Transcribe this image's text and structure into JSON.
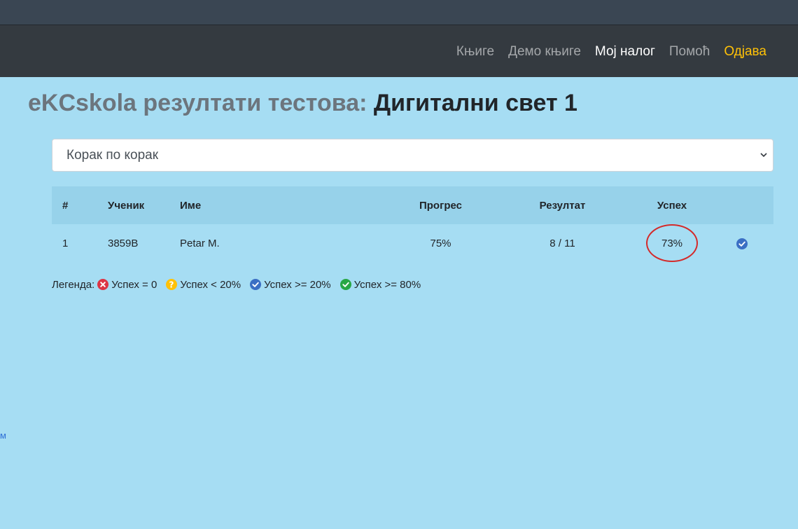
{
  "nav": {
    "items": [
      {
        "label": "Књиге"
      },
      {
        "label": "Демо књиге"
      },
      {
        "label": "Мој налог"
      },
      {
        "label": "Помоћ"
      },
      {
        "label": "Одјава"
      }
    ],
    "active_item": "Мој налог"
  },
  "page": {
    "title_prefix": "eKCskola резултати тестова:",
    "title_book": "Дигитални свет 1"
  },
  "lesson_select": {
    "selected": "Корак по корак"
  },
  "table": {
    "headers": {
      "num": "#",
      "student": "Ученик",
      "name": "Име",
      "progress": "Прогрес",
      "result": "Резултат",
      "success": "Успех"
    },
    "rows": [
      {
        "num": "1",
        "student": "3859B",
        "name": "Petar M.",
        "progress": "75%",
        "result": "8 / 11",
        "success": "73%",
        "status_icon": "blue-check-circle-icon"
      }
    ]
  },
  "legend": {
    "label": "Легенда:",
    "items": [
      {
        "icon": "red-x-circle-icon",
        "color": "#dc3545",
        "text": "Успех = 0"
      },
      {
        "icon": "yellow-question-circle-icon",
        "color": "#ffc107",
        "text": "Успех < 20%"
      },
      {
        "icon": "blue-check-circle-icon",
        "color": "#3b6fc4",
        "text": "Успех >= 20%"
      },
      {
        "icon": "green-check-circle-icon",
        "color": "#28a745",
        "text": "Успех >= 80%"
      }
    ]
  },
  "side_fragment": "м",
  "colors": {
    "page_bg": "#a6ddf3",
    "navbar_bg": "#343a40",
    "logout": "#ffc107",
    "annotation_circle": "#d42a2a"
  }
}
